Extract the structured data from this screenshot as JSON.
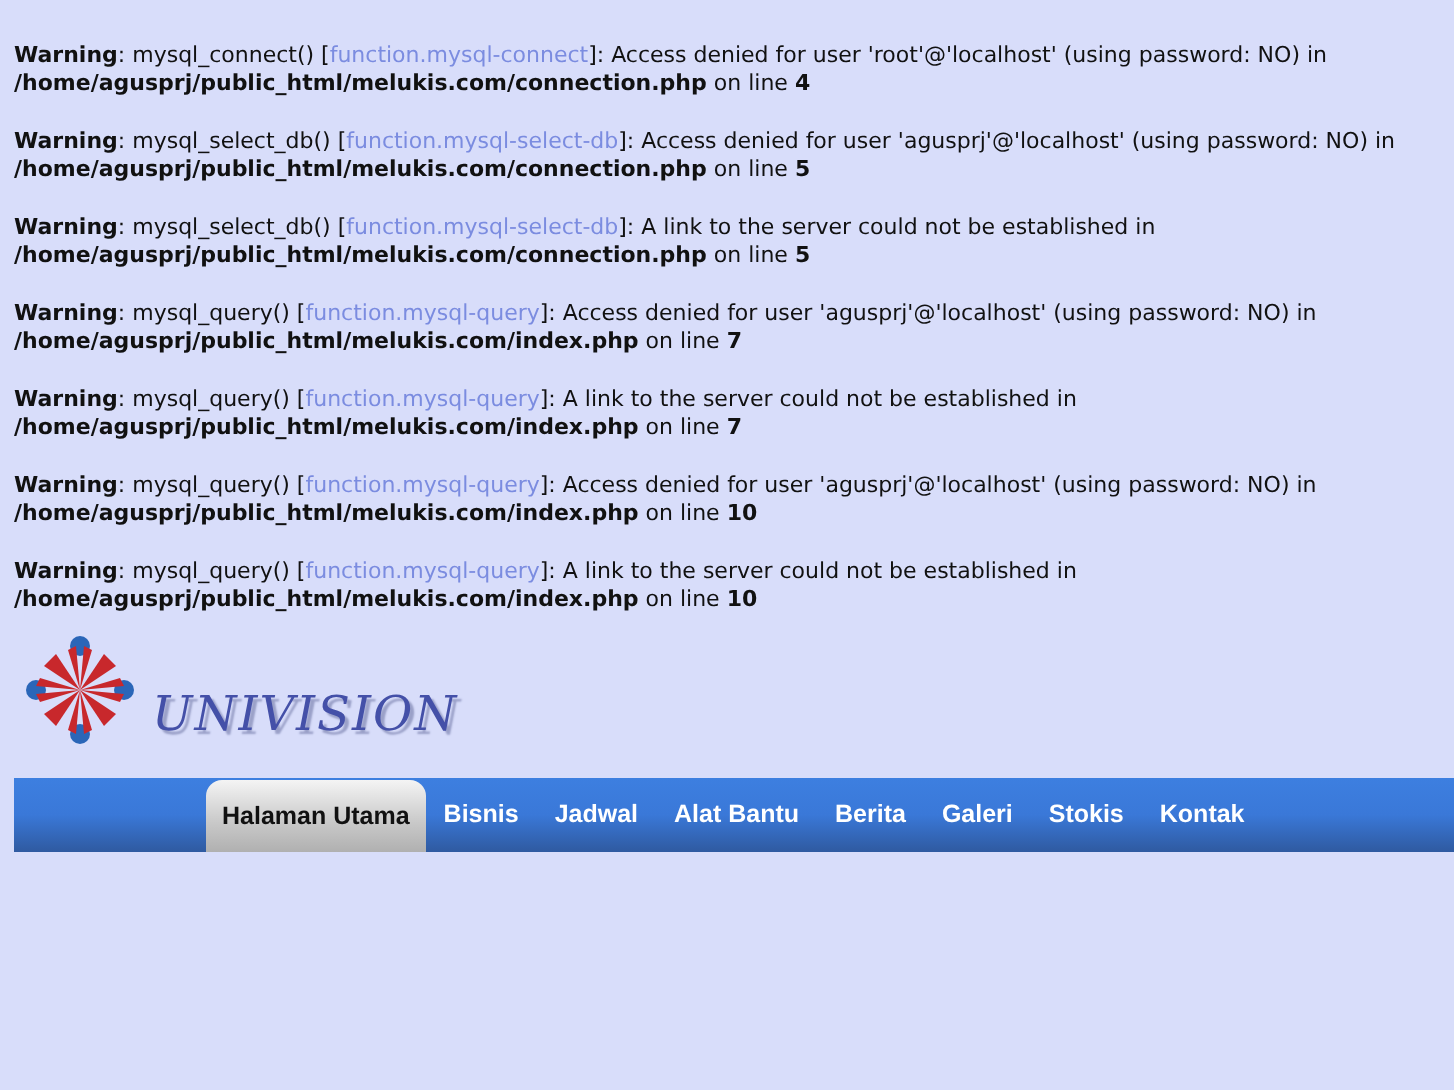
{
  "warnings": [
    {
      "label": "Warning",
      "text_1": ": mysql_connect() [",
      "link": "function.mysql-connect",
      "text_2": "]: Access denied for user 'root'@'localhost' (using password: NO) in",
      "file": "/home/agusprj/public_html/melukis.com/connection.php",
      "text_3": "on line",
      "line": "4"
    },
    {
      "label": "Warning",
      "text_1": ": mysql_select_db() [",
      "link": "function.mysql-select-db",
      "text_2": "]: Access denied for user 'agusprj'@'localhost' (using password: NO) in",
      "file": "/home/agusprj/public_html/melukis.com/connection.php",
      "text_3": "on line",
      "line": "5"
    },
    {
      "label": "Warning",
      "text_1": ": mysql_select_db() [",
      "link": "function.mysql-select-db",
      "text_2": "]: A link to the server could not be established in",
      "file": "/home/agusprj/public_html/melukis.com/connection.php",
      "text_3": "on line",
      "line": "5"
    },
    {
      "label": "Warning",
      "text_1": ": mysql_query() [",
      "link": "function.mysql-query",
      "text_2": "]: Access denied for user 'agusprj'@'localhost' (using password: NO) in",
      "file": "/home/agusprj/public_html/melukis.com/index.php",
      "text_3": "on line",
      "line": "7"
    },
    {
      "label": "Warning",
      "text_1": ": mysql_query() [",
      "link": "function.mysql-query",
      "text_2": "]: A link to the server could not be established in",
      "file": "/home/agusprj/public_html/melukis.com/index.php",
      "text_3": "on line",
      "line": "7"
    },
    {
      "label": "Warning",
      "text_1": ": mysql_query() [",
      "link": "function.mysql-query",
      "text_2": "]: Access denied for user 'agusprj'@'localhost' (using password: NO) in",
      "file": "/home/agusprj/public_html/melukis.com/index.php",
      "text_3": "on line",
      "line": "10"
    },
    {
      "label": "Warning",
      "text_1": ": mysql_query() [",
      "link": "function.mysql-query",
      "text_2": "]: A link to the server could not be established in",
      "file": "/home/agusprj/public_html/melukis.com/index.php",
      "text_3": "on line",
      "line": "10"
    }
  ],
  "logo": {
    "text": "UNIVISION"
  },
  "nav": [
    {
      "label": "Halaman Utama",
      "selected": true
    },
    {
      "label": "Bisnis",
      "selected": false
    },
    {
      "label": "Jadwal",
      "selected": false
    },
    {
      "label": "Alat Bantu",
      "selected": false
    },
    {
      "label": "Berita",
      "selected": false
    },
    {
      "label": "Galeri",
      "selected": false
    },
    {
      "label": "Stokis",
      "selected": false
    },
    {
      "label": "Kontak",
      "selected": false
    }
  ]
}
